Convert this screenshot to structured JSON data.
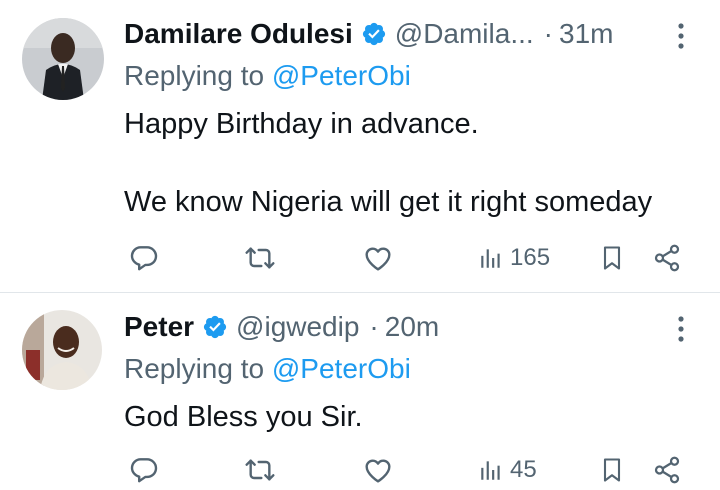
{
  "colors": {
    "accent": "#1d9bf0",
    "text_primary": "#0f1419",
    "text_secondary": "#536471",
    "divider": "#e1e6ea"
  },
  "replies": [
    {
      "display_name": "Damilare Odulesi",
      "verified": true,
      "handle": "@Damila...",
      "separator": "·",
      "time": "31m",
      "replying_prefix": "Replying to",
      "replying_to": "@PeterObi",
      "text_lines": [
        "Happy Birthday in advance.",
        "We know Nigeria will get it right someday"
      ],
      "views": "165",
      "icons": [
        "reply-icon",
        "retweet-icon",
        "like-icon",
        "views-icon",
        "bookmark-icon",
        "share-icon",
        "more-icon"
      ]
    },
    {
      "display_name": "Peter",
      "verified": true,
      "handle": "@igwedip",
      "separator": "·",
      "time": "20m",
      "replying_prefix": "Replying to",
      "replying_to": "@PeterObi",
      "text_lines": [
        "God Bless you Sir."
      ],
      "views": "45",
      "icons": [
        "reply-icon",
        "retweet-icon",
        "like-icon",
        "views-icon",
        "bookmark-icon",
        "share-icon",
        "more-icon"
      ]
    }
  ]
}
